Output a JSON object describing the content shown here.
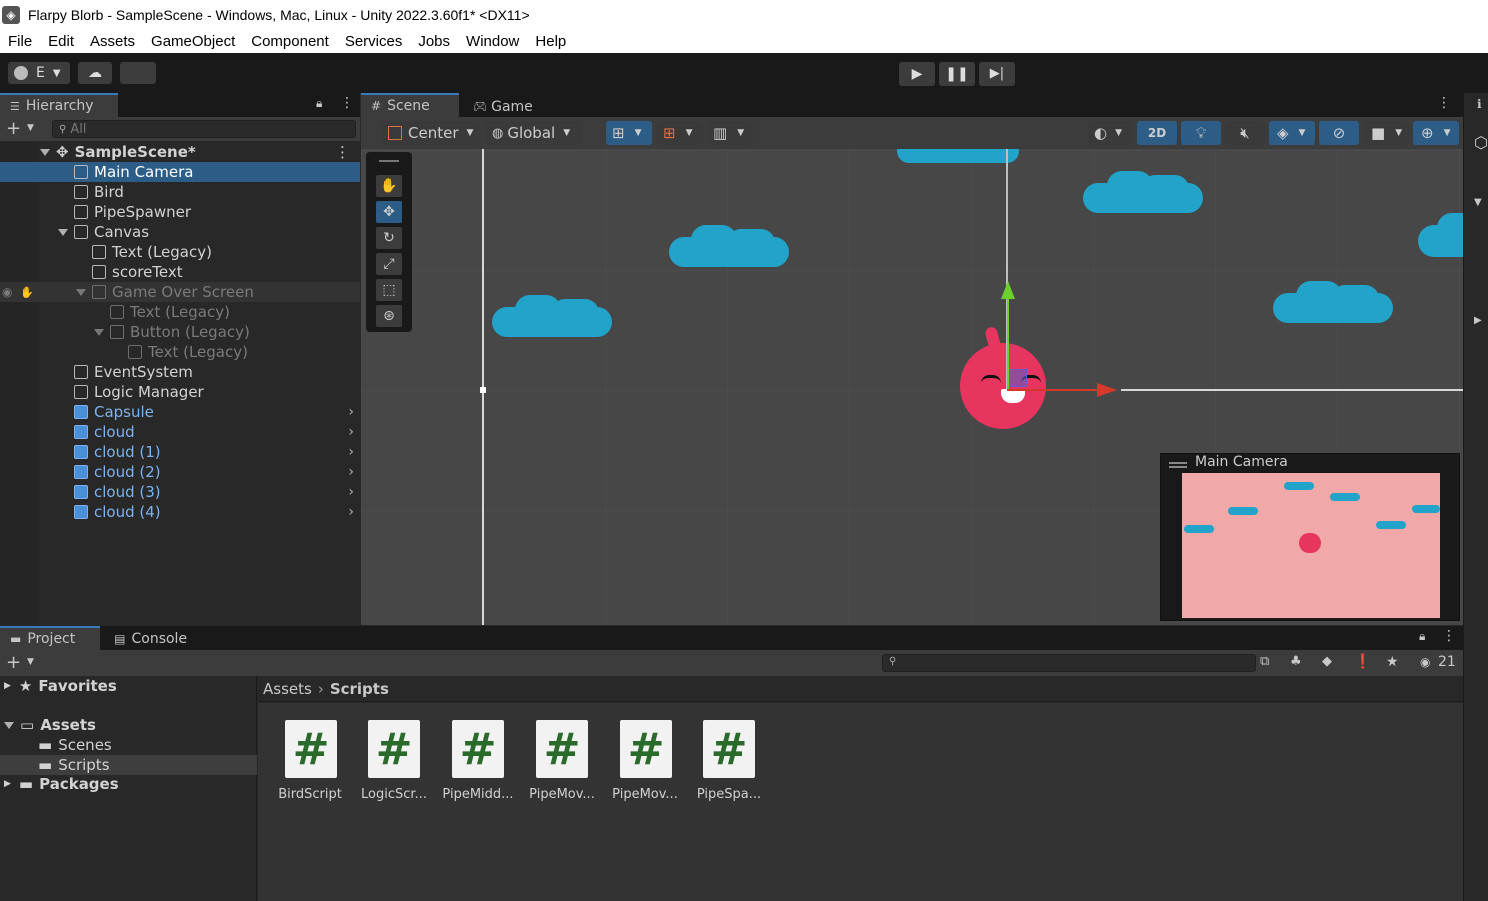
{
  "window": {
    "title": "Flarpy Blorb - SampleScene - Windows, Mac, Linux - Unity 2022.3.60f1* <DX11>"
  },
  "menu": [
    "File",
    "Edit",
    "Assets",
    "GameObject",
    "Component",
    "Services",
    "Jobs",
    "Window",
    "Help"
  ],
  "toolbar": {
    "account_label": "E"
  },
  "hierarchy": {
    "tab_label": "Hierarchy",
    "search_placeholder": "All",
    "scene_name": "SampleScene*",
    "items": [
      {
        "label": "Main Camera"
      },
      {
        "label": "Bird"
      },
      {
        "label": "PipeSpawner"
      },
      {
        "label": "Canvas"
      },
      {
        "label": "Text (Legacy)"
      },
      {
        "label": "scoreText"
      },
      {
        "label": "Game Over Screen"
      },
      {
        "label": "Text (Legacy)"
      },
      {
        "label": "Button (Legacy)"
      },
      {
        "label": "Text (Legacy)"
      },
      {
        "label": "EventSystem"
      },
      {
        "label": "Logic Manager"
      },
      {
        "label": "Capsule"
      },
      {
        "label": "cloud"
      },
      {
        "label": "cloud (1)"
      },
      {
        "label": "cloud (2)"
      },
      {
        "label": "cloud (3)"
      },
      {
        "label": "cloud (4)"
      }
    ]
  },
  "scene": {
    "tabs": [
      "Scene",
      "Game"
    ],
    "pivot_mode": "Center",
    "pivot_rotation": "Global",
    "mode_2d": "2D",
    "camera_preview_title": "Main Camera"
  },
  "project": {
    "tabs": [
      "Project",
      "Console"
    ],
    "visible_count": "21",
    "tree": {
      "favorites": "Favorites",
      "assets": "Assets",
      "scenes": "Scenes",
      "scripts": "Scripts",
      "packages": "Packages"
    },
    "breadcrumb": {
      "root": "Assets",
      "current": "Scripts"
    },
    "files": [
      "BirdScript",
      "LogicScr...",
      "PipeMidd...",
      "PipeMov...",
      "PipeMov...",
      "PipeSpa..."
    ]
  },
  "colors": {
    "sky": "#f0a8a8",
    "cloud": "#22a3c9",
    "bird": "#e8355f",
    "selection": "#2c5d87"
  }
}
